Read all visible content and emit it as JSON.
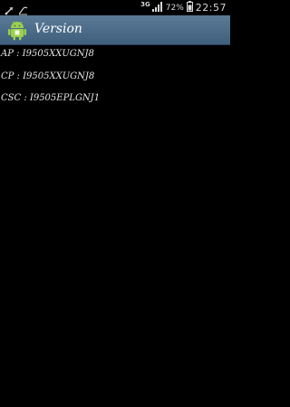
{
  "status_bar": {
    "network": "3G",
    "battery_percent": "72%",
    "time": "22:57",
    "icons": [
      "usb-icon",
      "mute-icon",
      "signal-icon",
      "battery-icon"
    ]
  },
  "action_bar": {
    "title": "Version",
    "icon": "android-icon",
    "color": "#4a6a88"
  },
  "versions": [
    {
      "label": "AP",
      "value": "I9505XXUGNJ8",
      "text": "AP : I9505XXUGNJ8"
    },
    {
      "label": "CP",
      "value": "I9505XXUGNJ8",
      "text": "CP : I9505XXUGNJ8"
    },
    {
      "label": "CSC",
      "value": "I9505EPLGNJ1",
      "text": "CSC : I9505EPLGNJ1"
    }
  ]
}
